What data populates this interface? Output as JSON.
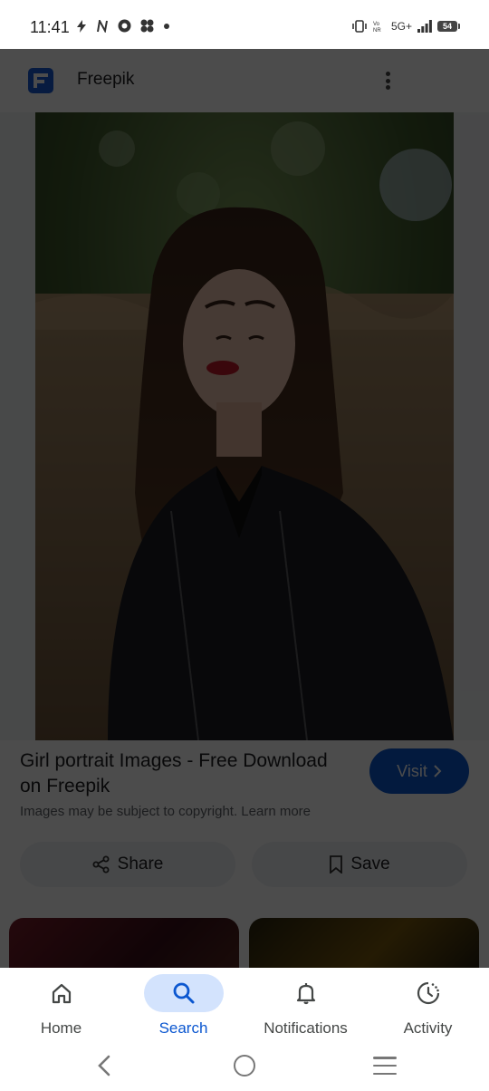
{
  "status_bar": {
    "time": "11:41",
    "network": "5G+",
    "battery": "54",
    "left_icons": [
      "flash-icon",
      "n-notification-icon",
      "app-notification-icon",
      "pinwheel-icon",
      "dot-icon"
    ],
    "right_icons": [
      "vibrate-icon",
      "volte-icon",
      "signal-icon",
      "battery-icon"
    ]
  },
  "header": {
    "title": "Freepik",
    "logo_color": "#1a5bd6",
    "menu_icon": "more-vert-icon"
  },
  "result": {
    "title": "Girl portrait Images - Free Download on Freepik",
    "copyright_text": "Images may be subject to copyright.",
    "learn_more": "Learn more",
    "visit_label": "Visit",
    "share_label": "Share",
    "save_label": "Save"
  },
  "bottom_nav": {
    "items": [
      {
        "label": "Home",
        "icon": "home-icon"
      },
      {
        "label": "Search",
        "icon": "search-icon",
        "active": true
      },
      {
        "label": "Notifications",
        "icon": "bell-icon"
      },
      {
        "label": "Activity",
        "icon": "activity-icon"
      }
    ]
  },
  "colors": {
    "accent": "#0b57d0",
    "active_pill": "#d3e3fd",
    "scrim": "rgba(0,0,0,0.70)"
  }
}
